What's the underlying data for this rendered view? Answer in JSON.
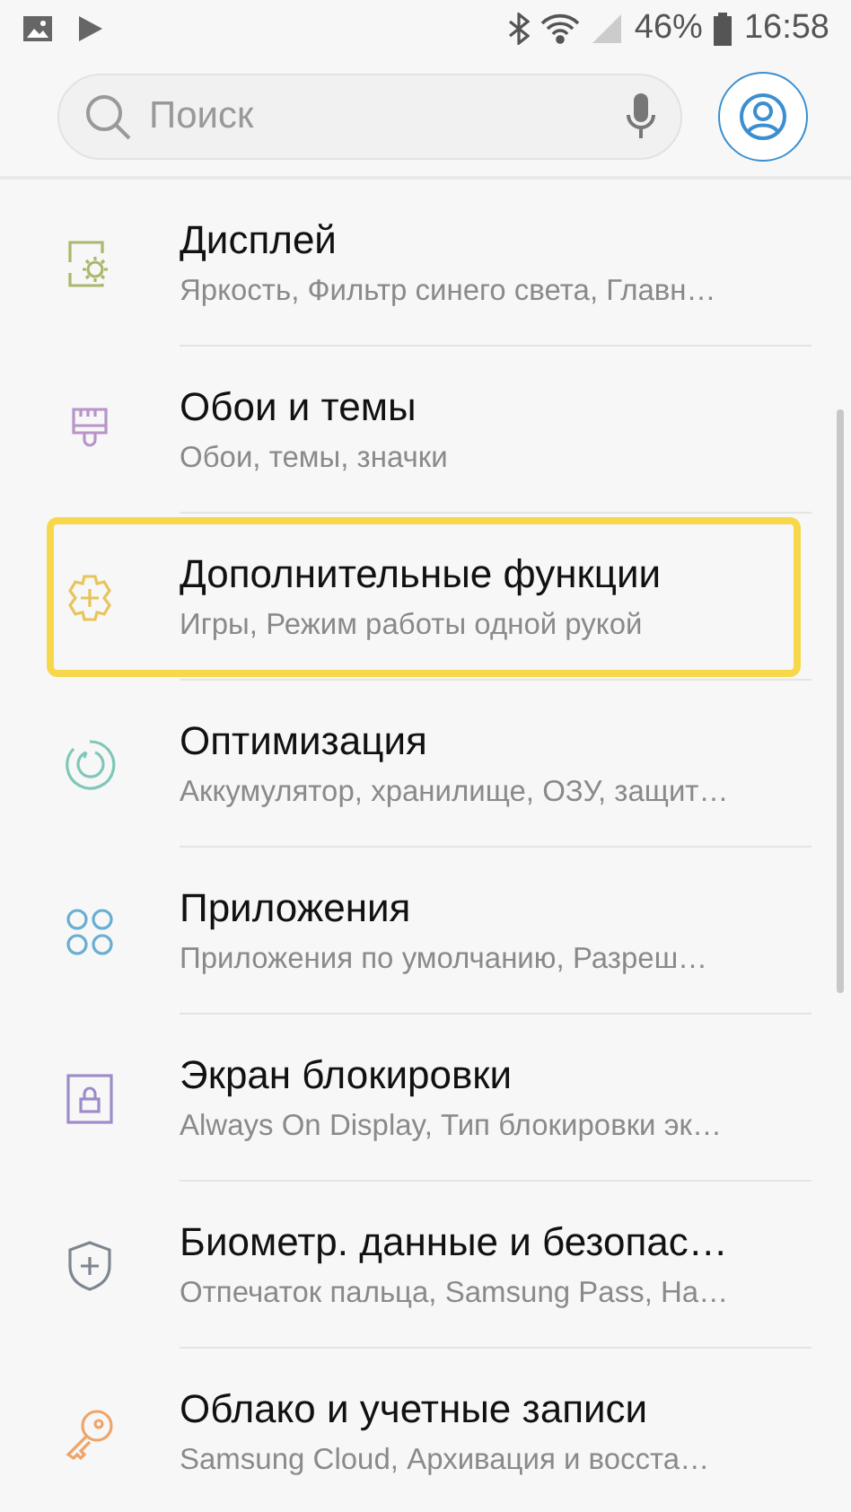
{
  "status_bar": {
    "battery_text": "46%",
    "time": "16:58"
  },
  "search": {
    "placeholder": "Поиск"
  },
  "items": [
    {
      "kind": "display",
      "color": "#a9b86a",
      "title": "Дисплей",
      "subtitle": "Яркость, Фильтр синего света, Главн…",
      "selected": false
    },
    {
      "kind": "brush",
      "color": "#b894c8",
      "title": "Обои и темы",
      "subtitle": "Обои, темы, значки",
      "selected": false
    },
    {
      "kind": "gear",
      "color": "#e8c45a",
      "title": "Дополнительные функции",
      "subtitle": "Игры, Режим работы одной рукой",
      "selected": true
    },
    {
      "kind": "refresh",
      "color": "#7fc7b8",
      "title": "Оптимизация",
      "subtitle": "Аккумулятор, хранилище, ОЗУ, защит…",
      "selected": false
    },
    {
      "kind": "apps",
      "color": "#6aaed0",
      "title": "Приложения",
      "subtitle": "Приложения по умолчанию, Разреш…",
      "selected": false
    },
    {
      "kind": "lock",
      "color": "#9d8cc9",
      "title": "Экран блокировки",
      "subtitle": "Always On Display, Тип блокировки эк…",
      "selected": false
    },
    {
      "kind": "shield",
      "color": "#7d8690",
      "title": "Биометр. данные и безопас…",
      "subtitle": "Отпечаток пальца, Samsung Pass, На…",
      "selected": false
    },
    {
      "kind": "key",
      "color": "#eea56a",
      "title": "Облако и учетные записи",
      "subtitle": "Samsung Cloud, Архивация и восста…",
      "selected": false
    }
  ]
}
